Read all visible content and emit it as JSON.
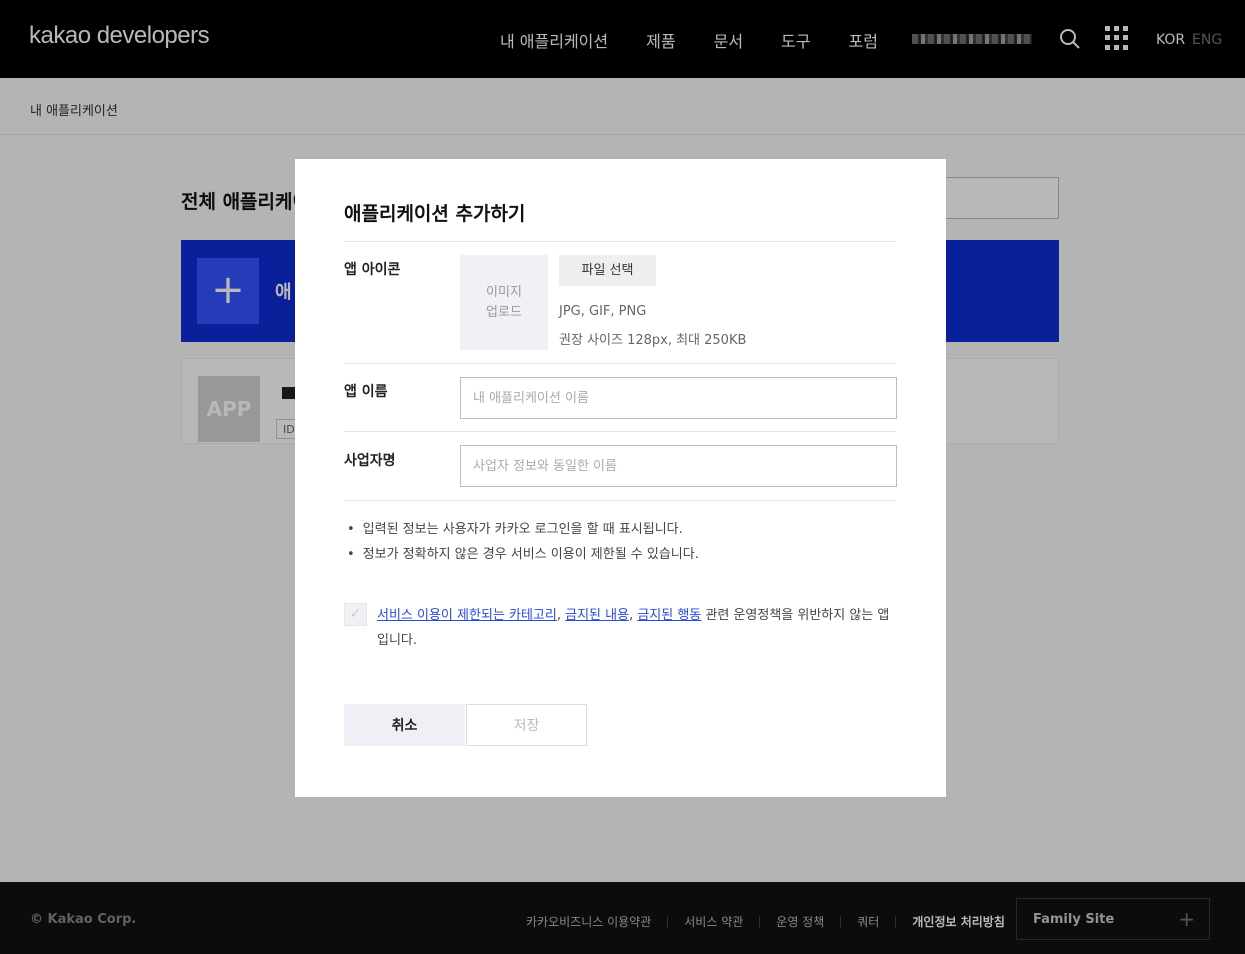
{
  "header": {
    "logo": "kakao developers",
    "nav": [
      "내 애플리케이션",
      "제품",
      "문서",
      "도구",
      "포럼"
    ],
    "lang_kor": "KOR",
    "lang_eng": "ENG"
  },
  "breadcrumb": "내 애플리케이션",
  "page": {
    "title": "전체 애플리케이",
    "add_card_text": "애",
    "app_thumb": "APP",
    "app_id_badge": "ID"
  },
  "footer": {
    "copyright": "© Kakao Corp.",
    "links": [
      "카카오비즈니스 이용약관",
      "서비스 약관",
      "운영 정책",
      "쿼터",
      "개인정보 처리방침"
    ],
    "family_site": "Family Site",
    "family_plus": "+"
  },
  "modal": {
    "title": "애플리케이션 추가하기",
    "icon_label": "앱 아이콘",
    "icon_upload": "이미지\n업로드",
    "file_button": "파일 선택",
    "icon_hint_formats": "JPG, GIF, PNG",
    "icon_hint_size": "권장 사이즈 128px, 최대 250KB",
    "app_name_label": "앱 이름",
    "app_name_value": "",
    "app_name_placeholder": "내 애플리케이션 이름",
    "company_label": "사업자명",
    "company_value": "",
    "company_placeholder": "사업자 정보와 동일한 이름",
    "notices": [
      "입력된 정보는 사용자가 카카오 로그인을 할 때 표시됩니다.",
      "정보가 정확하지 않은 경우 서비스 이용이 제한될 수 있습니다."
    ],
    "checkbox_mark": "✓",
    "policy": {
      "link1": "서비스 이용이 제한되는 카테고리",
      "sep1": ", ",
      "link2": "금지된 내용",
      "sep2": ", ",
      "link3": "금지된 행동",
      "rest": " 관련 운영정책을 위반하지 않는 앱입니다."
    },
    "cancel": "취소",
    "save": "저장"
  }
}
